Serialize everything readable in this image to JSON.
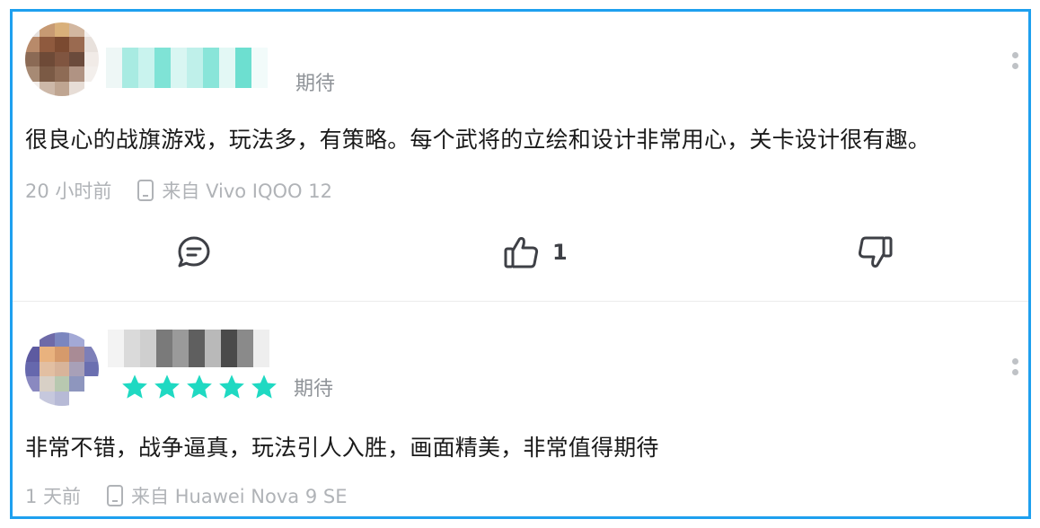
{
  "reviews": [
    {
      "username": "",
      "rating_label": "期待",
      "stars": null,
      "content": "很良心的战旗游戏，玩法多，有策略。每个武将的立绘和设计非常用心，关卡设计很有趣。",
      "time": "20 小时前",
      "device": "来自 Vivo IQOO 12",
      "likes": "1",
      "avatar_colors": [
        "#e6e0dc",
        "#c79a73",
        "#d9b07a",
        "#d2b7a0",
        "#f5f2f0",
        "#b88a6a",
        "#8f5a3e",
        "#7b4a31",
        "#9a6a50",
        "#e8e1dc",
        "#8b6a55",
        "#6e4a37",
        "#805540",
        "#6b4b3c",
        "#f1ebe7",
        "#a78a74",
        "#7b5a45",
        "#8e6b55",
        "#b09383",
        "#f3efec",
        "#f4efeb",
        "#cdb8a8",
        "#bfa591",
        "#e7ddd6",
        "#ffffff"
      ],
      "username_colors": [
        "#eef7f6",
        "#a8ebe2",
        "#c9f3ee",
        "#7fe3d6",
        "#d9f6f2",
        "#bff0ea",
        "#89e5d9",
        "#e3f8f5",
        "#6ddfd0",
        "#f2fbfa"
      ]
    },
    {
      "username": "",
      "rating_label": "期待",
      "stars": 5,
      "content": "非常不错，战争逼真，玩法引人入胜，画面精美，非常值得期待",
      "time": "1 天前",
      "device": "来自 Huawei Nova 9 SE",
      "likes": "",
      "avatar_colors": [
        "#ffffff",
        "#6e6aa8",
        "#7b86bf",
        "#a3a9d6",
        "#ffffff",
        "#5d5aa0",
        "#e9b27e",
        "#d69a6b",
        "#a98b95",
        "#7d7fb8",
        "#6668ad",
        "#e2bfa2",
        "#d8b49a",
        "#a8a0b8",
        "#6b6fb0",
        "#8a89c0",
        "#d8d0c6",
        "#b8c8b0",
        "#8e96be",
        "#ffffff",
        "#ffffff",
        "#c6c8dd",
        "#b7bad6",
        "#ffffff",
        "#ffffff"
      ],
      "username_colors": [
        "#f3f3f3",
        "#dadada",
        "#cfcfcf",
        "#7a7a7a",
        "#9a9a9a",
        "#5f5f5f",
        "#b9b9b9",
        "#4a4a4a",
        "#8a8a8a",
        "#eeeeee"
      ]
    }
  ],
  "colors": {
    "accent_star": "#1fd9c2",
    "border": "#1ea0ef",
    "icon": "#3e4046",
    "meta_text": "#b0b3b7"
  },
  "icons": {
    "reply": "chat-bubble-icon",
    "like": "thumbs-up-icon",
    "dislike": "thumbs-down-icon",
    "device": "phone-icon",
    "more": "more-vertical-icon"
  }
}
